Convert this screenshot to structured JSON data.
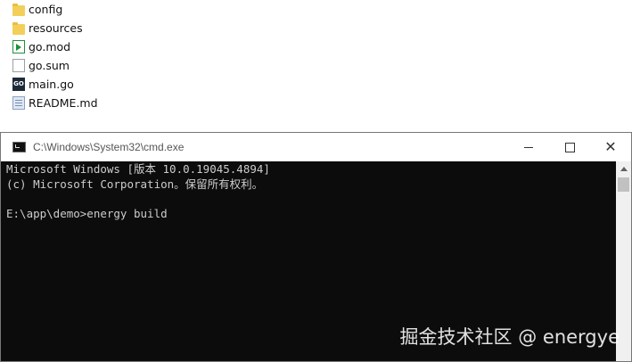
{
  "explorer": {
    "files": [
      {
        "name": "config",
        "icon": "folder-icon"
      },
      {
        "name": "resources",
        "icon": "folder-icon"
      },
      {
        "name": "go.mod",
        "icon": "go-mod-file-icon"
      },
      {
        "name": "go.sum",
        "icon": "file-icon"
      },
      {
        "name": "main.go",
        "icon": "go-file-icon"
      },
      {
        "name": "README.md",
        "icon": "markdown-file-icon"
      }
    ]
  },
  "cmd": {
    "title": "C:\\Windows\\System32\\cmd.exe",
    "lines": [
      "Microsoft Windows [版本 10.0.19045.4894]",
      "(c) Microsoft Corporation。保留所有权利。",
      "",
      "E:\\app\\demo>energy build"
    ],
    "buttons": {
      "minimize": "minimize",
      "maximize": "maximize",
      "close": "close"
    }
  },
  "watermark": "掘金技术社区 @ energye",
  "colors": {
    "console_bg": "#0c0c0c",
    "console_fg": "#cccccc",
    "folder": "#f3cf5a"
  }
}
